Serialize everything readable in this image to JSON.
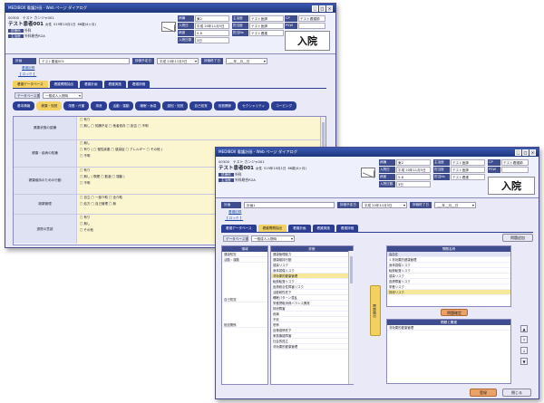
{
  "w1": {
    "title": "MEDIBOX 看護計画 - Web ページ ダイアログ",
    "patient": {
      "id": "00300",
      "kana": "テスト カンジャ001",
      "name": "テスト患者001",
      "sex": "女性",
      "birth": "S19年10月1日",
      "age": "66歳(4ヶ月)",
      "dept": "外科",
      "attr_label": "診療科",
      "doctor_label": "主治医",
      "doctor": "外科総合R2A"
    },
    "info": [
      {
        "label": "病棟",
        "value": "東2"
      },
      {
        "label": "入院日",
        "value": "平成 20年11月5日"
      },
      {
        "label": "病室",
        "value": "5-8"
      },
      {
        "label": "入院日数",
        "value": "3日"
      }
    ],
    "info2": [
      {
        "label": "主治医",
        "value": "テスト医師"
      },
      {
        "label": "担当医",
        "value": "テスト医師"
      },
      {
        "label": "担当Ns",
        "value": "テスト看護"
      }
    ],
    "info3": [
      {
        "label": "CP",
        "value": "テスト看護師"
      },
      {
        "label": "PSW",
        "value": ""
      },
      {
        "label": "OT",
        "value": ""
      }
    ],
    "badge": "入院",
    "plan_label": "計画",
    "plan_value": "テスト患者001",
    "date_label": "評価予定日",
    "date_value": "平成 20年11月5日",
    "eval_label": "評価終了日",
    "eval_value": "___年__月__日",
    "link1": "看護記録",
    "link2": "【 ロック 】",
    "tabs": [
      "看護データベース",
      "看護問題抽出",
      "看護計画",
      "看護実施",
      "看護評価"
    ],
    "db_label": "データベース選択",
    "db_value": "一般成人入院時",
    "pills": [
      "基本情報",
      "健康・知覚",
      "栄養・代謝",
      "排泄",
      "活動・運動",
      "睡眠・休息",
      "認知・知覚",
      "自己知覚",
      "役割関係",
      "セクシャリティ",
      "コーピング",
      "価値・信念"
    ],
    "form": [
      {
        "label": "健康状態の認識",
        "lines": [
          "□ 有り",
          "□ 無し □ 知識不足 □ 他者依存 □ 拒否 □ 不明"
        ]
      },
      {
        "label": "健康・疾病の知識",
        "lines": [
          "□ 無し",
          "□ 有り ( □ 慢性疾患 □ 感染症 □ アレルギー □ その他 )",
          "□ 不明"
        ]
      },
      {
        "label": "健康維持のための行動",
        "lines": [
          "□ 有り",
          "□ 無し ( 喫煙 □ 飲酒 □ 運動 )",
          "□ 不明"
        ]
      },
      {
        "label": "服薬管理",
        "lines": [
          "□ 自立 □ 一部介助 □ 全介助",
          "□ 処方 □ 自己管理 □ 無"
        ]
      },
      {
        "label": "退院の意欲",
        "lines": [
          "□ 有り",
          "□ 無し",
          "□ その他"
        ]
      }
    ]
  },
  "w2": {
    "title": "MEDIBOX 看護計画 - Web ページ ダイアログ",
    "plan_value": "計画1",
    "tabs": [
      "看護データベース",
      "看護問題抽出",
      "看護計画",
      "看護実施",
      "看護評価"
    ],
    "add_button": "問題追加",
    "col1_header": "領域",
    "col2_header": "診断",
    "col3_header": "問題名称",
    "categories": [
      {
        "cat": "健康知覚",
        "items": [
          "健康管理",
          "健康維持",
          "その他"
        ]
      },
      {
        "cat": "活動・運動",
        "items": [
          "転倒・転落",
          "活動耐性低下",
          "身体可動性障害",
          "活動・運動その他"
        ]
      },
      {
        "cat": "自己知覚",
        "items": [
          "不安",
          "恐怖",
          "自尊感情"
        ]
      },
      {
        "cat": "役割関係",
        "items": [
          "家族機能",
          "社会的孤立",
          "役割遂行"
        ]
      }
    ],
    "mid_items": [
      "健康管理能力",
      "健康維持行動",
      "感染リスク",
      "身体損傷リスク",
      "転倒転落リスク",
      "皮膚統合性障害リスク",
      "非効果的健康管理",
      "活動耐性低下",
      "睡眠パターン混乱",
      "栄養摂取消費バランス異常",
      "排泄障害",
      "疼痛",
      "不安",
      "恐怖",
      "自尊感情低下",
      "家族機能障害",
      "社会的孤立"
    ],
    "highlighted_item": "非効果的健康管理",
    "mid_button": "問題抽出",
    "right_items": [
      "高血圧",
      "1 非効果的健康管理",
      "身体損傷リスク",
      "転倒転落リスク",
      "感染リスク",
      "皮膚障害リスク",
      "栄養リスク",
      "排泄リスク"
    ],
    "confirm_button": "問題確定",
    "lower_header": "問題と関連",
    "lower_item": "非効果的健康管理",
    "ok_button": "登録",
    "close_button": "閉じる"
  }
}
